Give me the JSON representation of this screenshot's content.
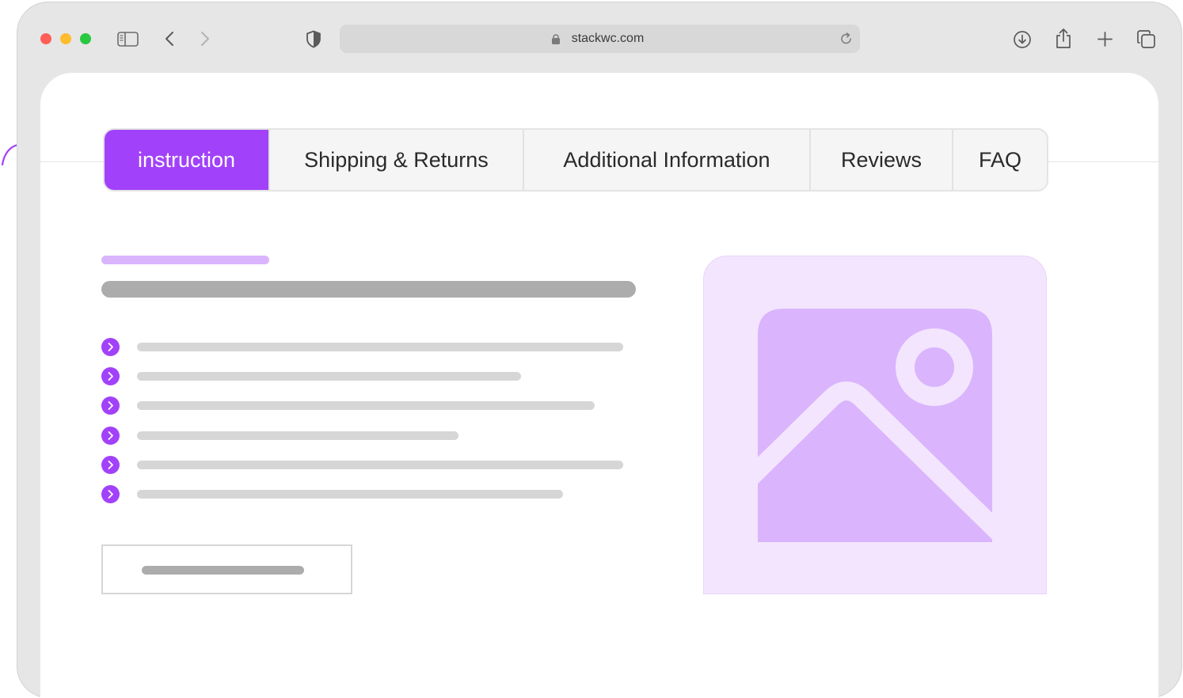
{
  "browser": {
    "url": "stackwc.com"
  },
  "tabs": [
    {
      "label": "instruction",
      "active": true
    },
    {
      "label": "Shipping & Returns",
      "active": false
    },
    {
      "label": "Additional Information",
      "active": false
    },
    {
      "label": "Reviews",
      "active": false
    },
    {
      "label": "FAQ",
      "active": false
    }
  ],
  "colors": {
    "accent": "#a241fa",
    "accent_light": "#dab4fd",
    "placeholder_bg": "#f3e5fd",
    "text_skeleton_dark": "#acacac",
    "text_skeleton_light": "#d6d6d6"
  },
  "icons": [
    "sidebar-icon",
    "back-icon",
    "forward-icon",
    "shield-icon",
    "lock-icon",
    "reload-icon",
    "download-icon",
    "share-icon",
    "new-tab-icon",
    "tabs-overview-icon",
    "chevron-right-icon",
    "image-placeholder-icon",
    "curly-arrow-icon"
  ]
}
